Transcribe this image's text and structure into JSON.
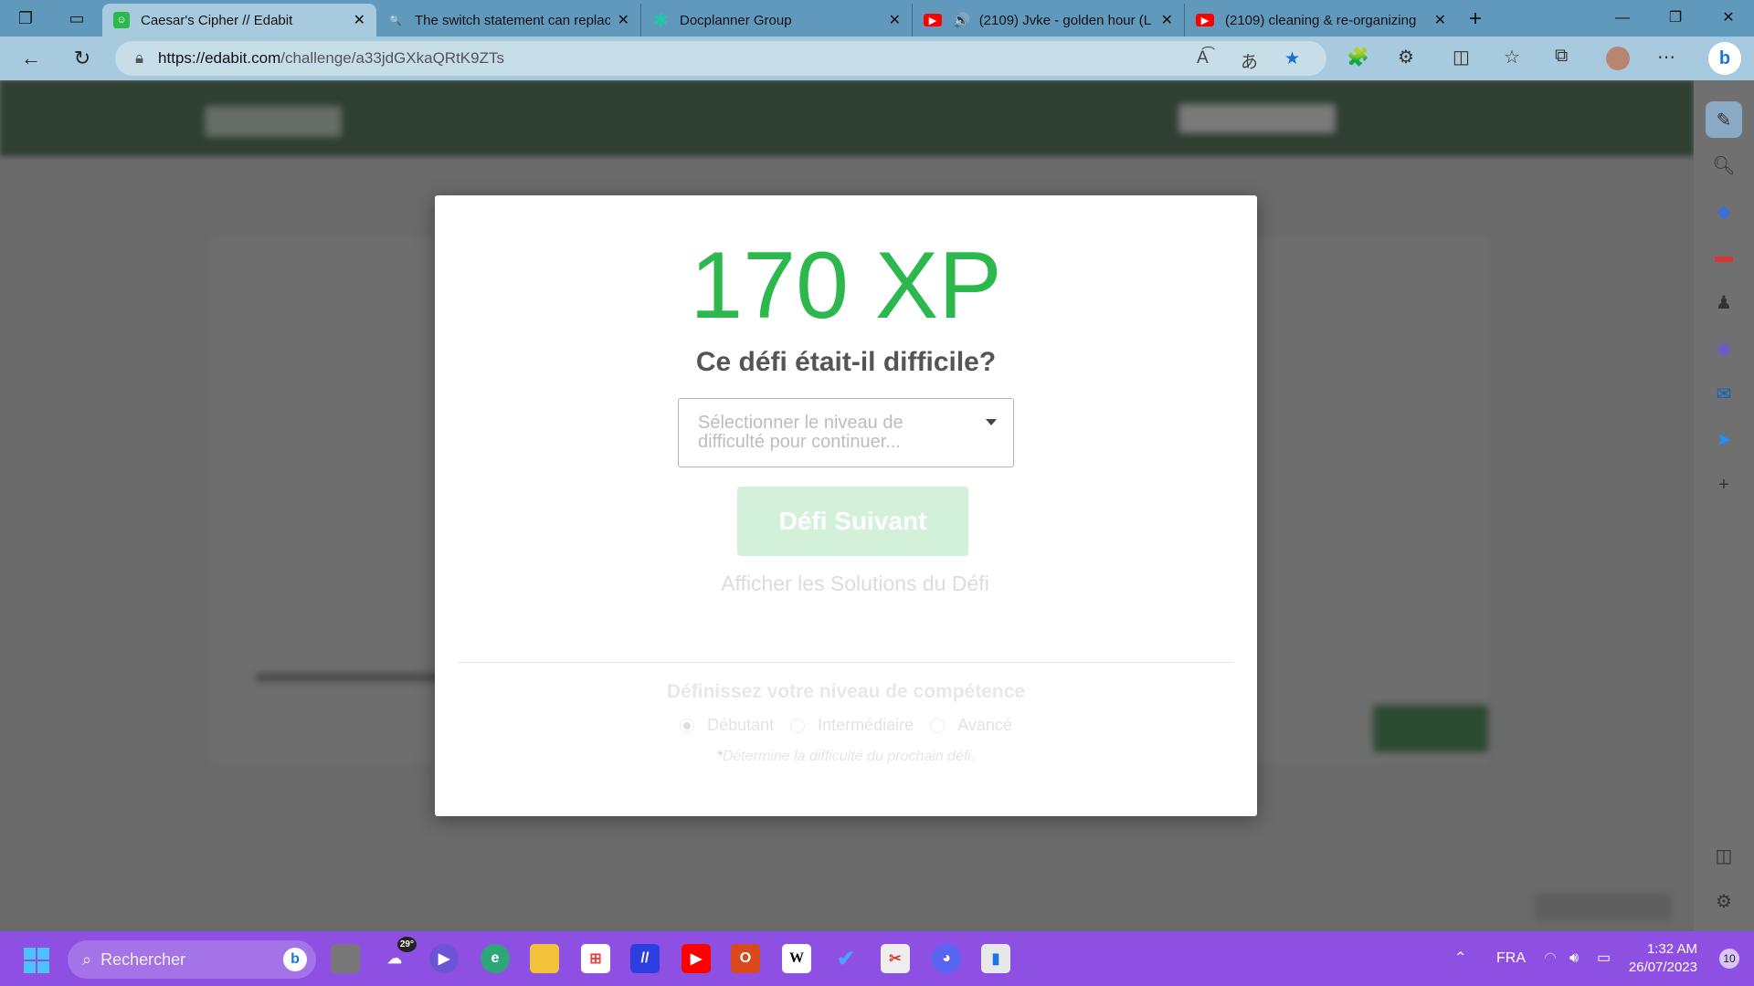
{
  "browser": {
    "tabs": [
      {
        "label": "Caesar's Cipher // Edabit",
        "icon": "edabit-icon",
        "active": true
      },
      {
        "label": "The switch statement can replace",
        "icon": "search-icon",
        "active": false
      },
      {
        "label": "Docplanner Group",
        "icon": "docplanner-icon",
        "active": false
      },
      {
        "label": "(2109) Jvke - golden hour (L",
        "icon": "youtube-icon",
        "active": false
      },
      {
        "label": "(2109) cleaning & re-organizing",
        "icon": "youtube-icon",
        "active": false
      }
    ],
    "url_host": "https://edabit.com",
    "url_path": "/challenge/a33jdGXkaQRtK9ZTs"
  },
  "modal": {
    "xp": "170 XP",
    "question": "Ce défi était-il difficile?",
    "difficulty_placeholder": "Sélectionner le niveau de difficulté pour continuer...",
    "next_button": "Défi Suivant",
    "solutions_link": "Afficher les Solutions du Défi",
    "skill_heading": "Définissez votre niveau de compétence",
    "levels": [
      {
        "label": "Débutant",
        "selected": true
      },
      {
        "label": "Intermédiaire",
        "selected": false
      },
      {
        "label": "Avancé",
        "selected": false
      }
    ],
    "note_asterisk": "*",
    "note": "Détermine la difficulté du prochain défi."
  },
  "taskbar": {
    "search_placeholder": "Rechercher",
    "weather": "29°",
    "language": "FRA",
    "time": "1:32 AM",
    "date": "26/07/2023",
    "notifications": "10"
  },
  "colors": {
    "xp_green": "#2db84d",
    "taskbar": "#8e50e2",
    "tabbar": "#6199bd"
  }
}
